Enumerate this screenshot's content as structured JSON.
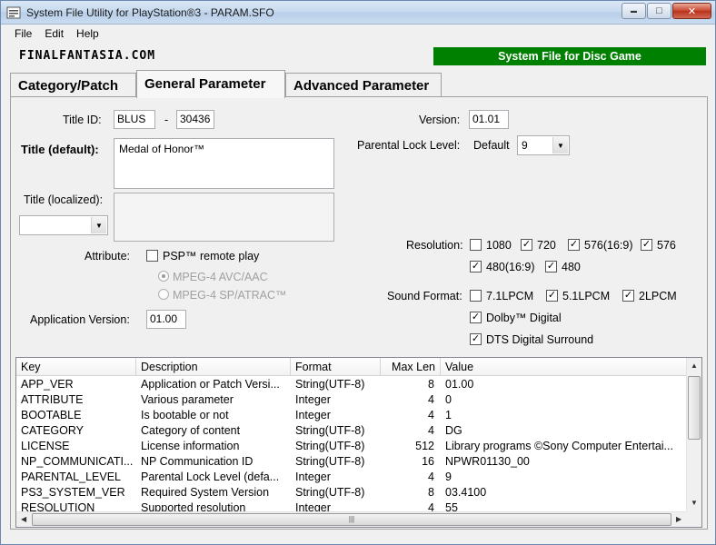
{
  "window": {
    "title": "System File Utility for PlayStation®3 - PARAM.SFO",
    "controls": {
      "minimize": "▬",
      "maximize": "□",
      "close": "✕"
    }
  },
  "menu": [
    "File",
    "Edit",
    "Help"
  ],
  "header": {
    "logo": "FINALFANTASIA.COM",
    "banner": "System File for Disc Game",
    "banner_color": "#008000"
  },
  "tabs": [
    "Category/Patch",
    "General Parameter",
    "Advanced Parameter"
  ],
  "form": {
    "title_id_label": "Title ID:",
    "title_id_prefix": "BLUS",
    "title_id_sep": "-",
    "title_id_number": "30436",
    "title_default_label": "Title (default):",
    "title_default_value": "Medal of Honor™",
    "title_localized_label": "Title (localized):",
    "title_localized_value": "",
    "attribute_label": "Attribute:",
    "psp_remote_play": "PSP™ remote play",
    "mpeg4_avc": "MPEG-4 AVC/AAC",
    "mpeg4_sp": "MPEG-4 SP/ATRAC™",
    "app_version_label": "Application Version:",
    "app_version_value": "01.00",
    "version_label": "Version:",
    "version_value": "01.01",
    "parental_label": "Parental Lock Level:",
    "parental_default": "Default",
    "parental_value": "9",
    "resolution_label": "Resolution:",
    "res_1080": "1080",
    "res_720": "720",
    "res_576_169": "576(16:9)",
    "res_576": "576",
    "res_480_169": "480(16:9)",
    "res_480": "480",
    "sound_label": "Sound Format:",
    "snd_71": "7.1LPCM",
    "snd_51": "5.1LPCM",
    "snd_2": "2LPCM",
    "snd_dolby": "Dolby™ Digital",
    "snd_dts": "DTS Digital Surround"
  },
  "list": {
    "columns": [
      "Key",
      "Description",
      "Format",
      "Max Len",
      "Value"
    ],
    "rows": [
      [
        "APP_VER",
        "Application or Patch Versi...",
        "String(UTF-8)",
        "8",
        "01.00"
      ],
      [
        "ATTRIBUTE",
        "Various parameter",
        "Integer",
        "4",
        "0"
      ],
      [
        "BOOTABLE",
        "Is bootable or not",
        "Integer",
        "4",
        "1"
      ],
      [
        "CATEGORY",
        "Category of content",
        "String(UTF-8)",
        "4",
        "DG"
      ],
      [
        "LICENSE",
        "License information",
        "String(UTF-8)",
        "512",
        "Library programs ©Sony Computer Entertai..."
      ],
      [
        "NP_COMMUNICATI...",
        "NP Communication ID",
        "String(UTF-8)",
        "16",
        "NPWR01130_00"
      ],
      [
        "PARENTAL_LEVEL",
        "Parental Lock Level (defa...",
        "Integer",
        "4",
        "9"
      ],
      [
        "PS3_SYSTEM_VER",
        "Required System Version",
        "String(UTF-8)",
        "8",
        "03.4100"
      ],
      [
        "RESOLUTION",
        "Supported resolution",
        "Integer",
        "4",
        "55"
      ]
    ]
  }
}
